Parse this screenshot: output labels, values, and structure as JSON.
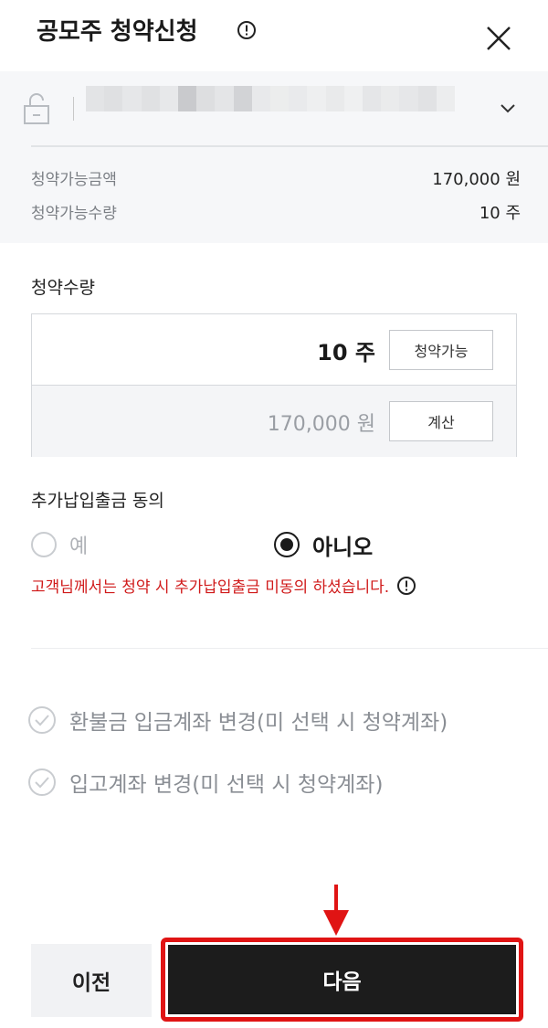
{
  "header": {
    "title": "공모주 청약신청"
  },
  "account": {
    "masked_value": ""
  },
  "summary": {
    "available_amount_label": "청약가능금액",
    "available_amount_value": "170,000 원",
    "available_qty_label": "청약가능수량",
    "available_qty_value": "10 주"
  },
  "quantity": {
    "label": "청약수량",
    "qty_value": "10 주",
    "qty_button": "청약가능",
    "amount_value": "170,000 원",
    "amount_button": "계산"
  },
  "extra_payment": {
    "label": "추가납입출금 동의",
    "options": [
      "예",
      "아니오"
    ],
    "selected": "아니오",
    "warning": "고객님께서는 청약 시 추가납입출금 미동의 하셨습니다."
  },
  "options": {
    "refund_account_change": "환불금 입금계좌 변경(미 선택 시 청약계좌)",
    "stock_account_change": "입고계좌 변경(미 선택 시 청약계좌)"
  },
  "footer": {
    "prev_label": "이전",
    "next_label": "다음"
  },
  "colors": {
    "warning": "#d01a1a",
    "primary_button": "#1c1c1c",
    "highlight_outline": "#e01414"
  },
  "icons": [
    "info-icon",
    "close-icon",
    "lock-icon",
    "chevron-down-icon",
    "check-circle-icon",
    "arrow-down-icon"
  ]
}
